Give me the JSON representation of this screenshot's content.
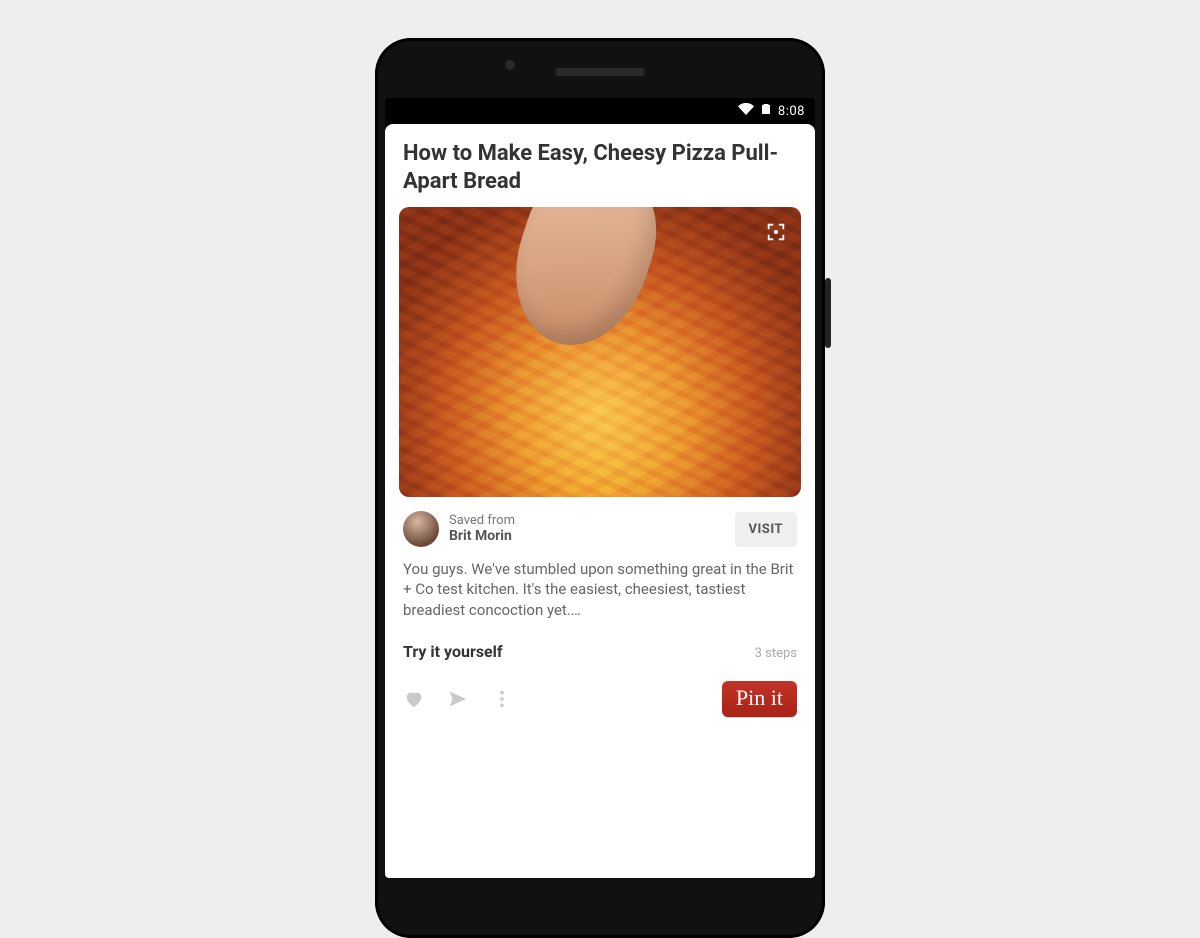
{
  "status": {
    "time": "8:08"
  },
  "pin": {
    "title": "How to Make Easy, Cheesy Pizza Pull-Apart Bread",
    "saved_from_label": "Saved from",
    "author": "Brit Morin",
    "visit_label": "VISIT",
    "description": "You guys. We've stumbled upon something great in the Brit + Co test kitchen. It's the easiest, cheesiest, tastiest breadiest concoction yet.…",
    "try_label": "Try it yourself",
    "steps_label": "3 steps",
    "pinit_label": "Pin it"
  },
  "icons": {
    "expand": "expand-icon",
    "heart": "heart-icon",
    "send": "send-icon",
    "more": "more-icon",
    "wifi": "wifi-icon",
    "battery": "battery-icon"
  }
}
